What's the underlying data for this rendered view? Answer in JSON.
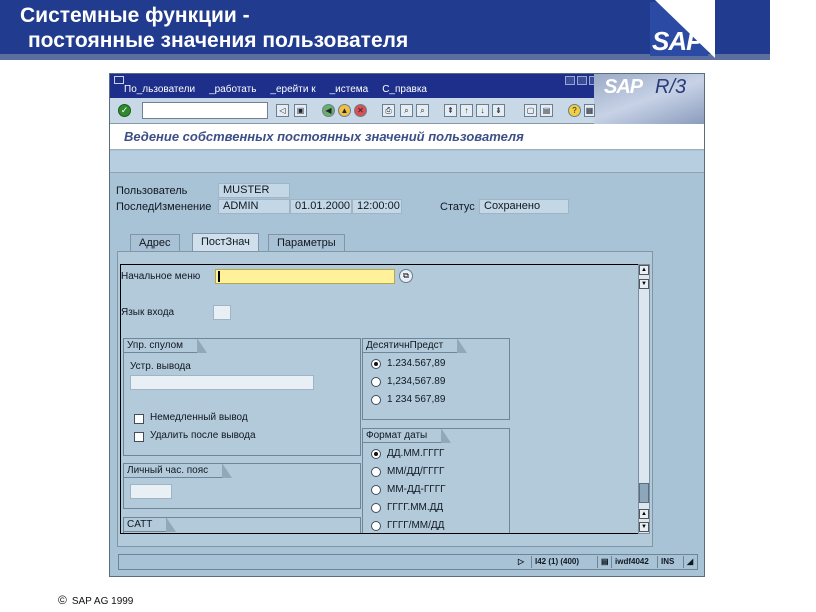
{
  "slide": {
    "title_line1": "Системные функции -",
    "title_line2": "постоянные значения пользователя",
    "logo": "SAP",
    "copyright_symbol": "©",
    "copyright_text": "SAP AG 1999"
  },
  "window": {
    "menu": [
      "По_льзователи",
      "_работать",
      "_ерейти к",
      "_истема",
      "С_правка"
    ],
    "logo_sap": "SAP",
    "logo_r3": "R/3",
    "screen_title": "Ведение собственных постоянных значений пользователя"
  },
  "header_fields": {
    "user_label": "Пользователь",
    "user_value": "MUSTER",
    "changed_label": "ПоследИзменение",
    "changed_by": "ADMIN",
    "changed_date": "01.01.2000",
    "changed_time": "12:00:00",
    "status_label": "Статус",
    "status_value": "Сохранено"
  },
  "tabs": [
    {
      "label": "Адрес",
      "active": false
    },
    {
      "label": "ПостЗнач",
      "active": true
    },
    {
      "label": "Параметры",
      "active": false
    }
  ],
  "defaults": {
    "start_menu_label": "Начальное меню",
    "start_menu_value": "",
    "logon_lang_label": "Язык входа",
    "logon_lang_value": "",
    "spool": {
      "title": "Упр. спулом",
      "output_device_label": "Устр. вывода",
      "output_device_value": "",
      "checkboxes": [
        {
          "label": "Немедленный вывод",
          "checked": false
        },
        {
          "label": "Удалить после вывода",
          "checked": false
        }
      ]
    },
    "timezone": {
      "title": "Личный час. пояс",
      "value": ""
    },
    "catt": {
      "title": "CATT"
    },
    "decimal": {
      "title": "ДесятичнПредст",
      "options": [
        {
          "label": "1.234.567,89",
          "selected": true
        },
        {
          "label": "1,234,567.89",
          "selected": false
        },
        {
          "label": "1 234 567,89",
          "selected": false
        }
      ]
    },
    "date_format": {
      "title": "Формат даты",
      "options": [
        {
          "label": "ДД.ММ.ГГГГ",
          "selected": true
        },
        {
          "label": "ММ/ДД/ГГГГ",
          "selected": false
        },
        {
          "label": "ММ-ДД-ГГГГ",
          "selected": false
        },
        {
          "label": "ГГГГ.ММ.ДД",
          "selected": false
        },
        {
          "label": "ГГГГ/ММ/ДД",
          "selected": false
        }
      ]
    }
  },
  "statusbar": {
    "system": "I42 (1) (400)",
    "server": "iwdf4042",
    "mode": "INS"
  }
}
